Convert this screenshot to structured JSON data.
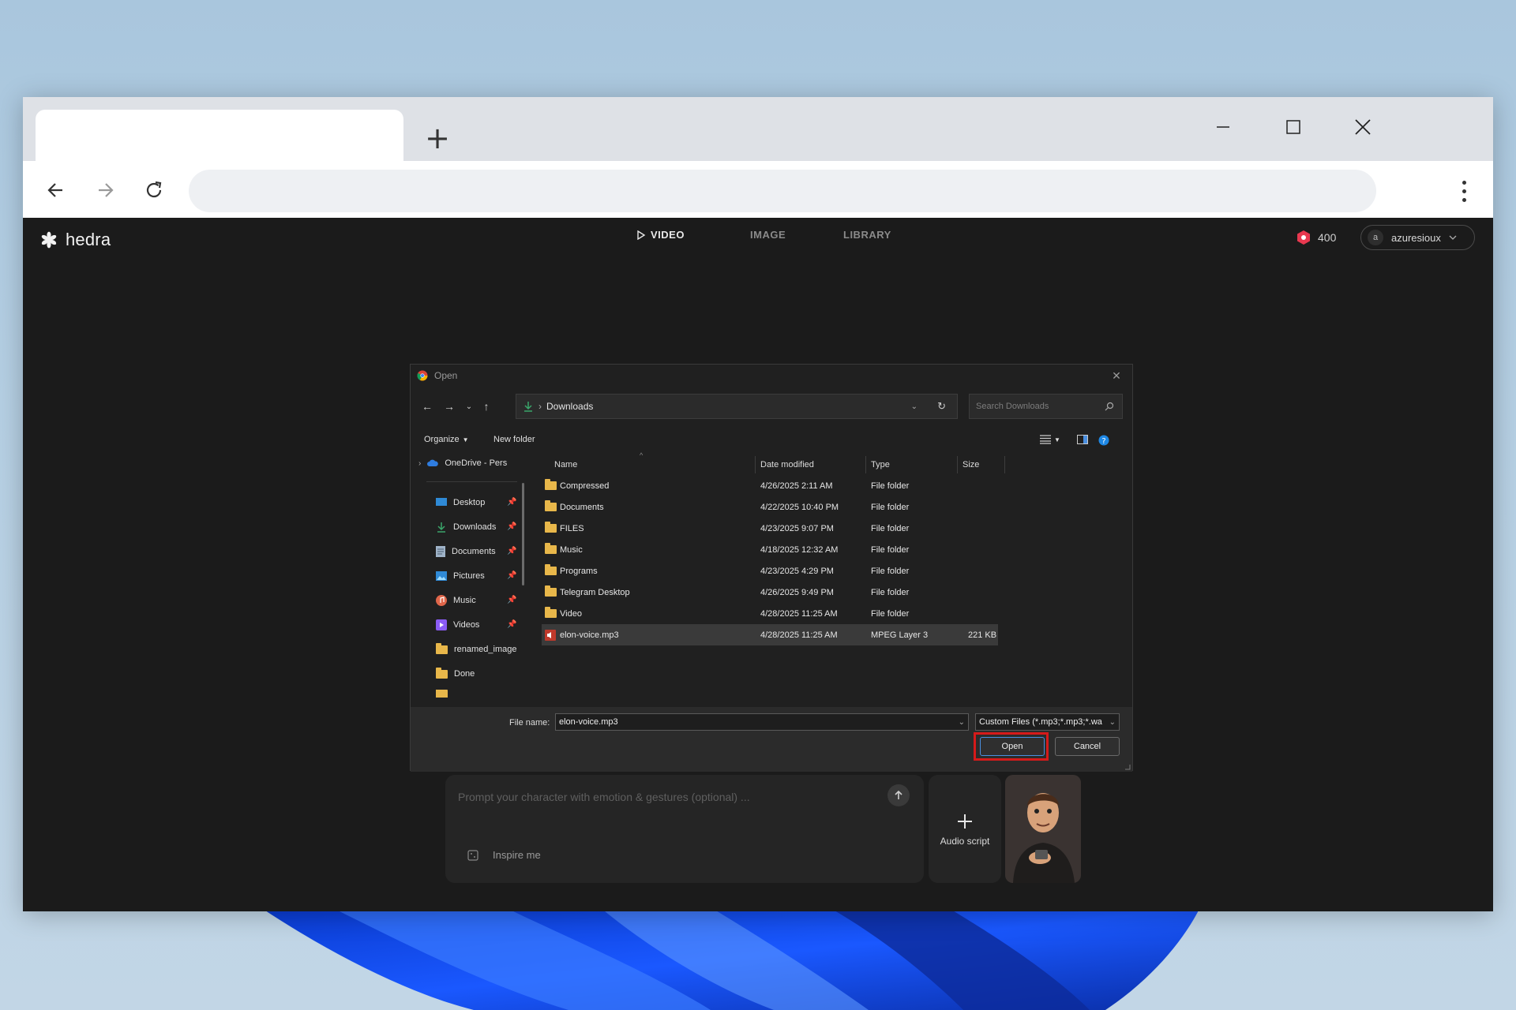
{
  "app": {
    "brand": "hedra",
    "nav": [
      {
        "label": "VIDEO",
        "active": true
      },
      {
        "label": "IMAGE",
        "active": false
      },
      {
        "label": "LIBRARY",
        "active": false
      }
    ],
    "credits": "400",
    "user": {
      "initial": "a",
      "name": "azuresioux"
    },
    "prompt_placeholder": "Prompt your character with emotion & gestures (optional) ...",
    "inspire_label": "Inspire me",
    "audio_script_label": "Audio script"
  },
  "dialog": {
    "title": "Open",
    "path": "Downloads",
    "search_placeholder": "Search Downloads",
    "organize_label": "Organize",
    "new_folder_label": "New folder",
    "nav_items": [
      {
        "label": "OneDrive - Pers",
        "icon": "cloud-icon"
      },
      {
        "label": "Desktop",
        "icon": "desktop-icon",
        "pinned": true
      },
      {
        "label": "Downloads",
        "icon": "download-icon",
        "pinned": true
      },
      {
        "label": "Documents",
        "icon": "document-icon",
        "pinned": true
      },
      {
        "label": "Pictures",
        "icon": "picture-icon",
        "pinned": true
      },
      {
        "label": "Music",
        "icon": "music-icon",
        "pinned": true
      },
      {
        "label": "Videos",
        "icon": "video-icon",
        "pinned": true
      },
      {
        "label": "renamed_image",
        "icon": "folder-icon"
      },
      {
        "label": "Done",
        "icon": "folder-icon"
      }
    ],
    "columns": {
      "name": "Name",
      "date": "Date modified",
      "type": "Type",
      "size": "Size"
    },
    "files": [
      {
        "name": "Compressed",
        "date": "4/26/2025 2:11 AM",
        "type": "File folder",
        "size": ""
      },
      {
        "name": "Documents",
        "date": "4/22/2025 10:40 PM",
        "type": "File folder",
        "size": ""
      },
      {
        "name": "FILES",
        "date": "4/23/2025 9:07 PM",
        "type": "File folder",
        "size": ""
      },
      {
        "name": "Music",
        "date": "4/18/2025 12:32 AM",
        "type": "File folder",
        "size": ""
      },
      {
        "name": "Programs",
        "date": "4/23/2025 4:29 PM",
        "type": "File folder",
        "size": ""
      },
      {
        "name": "Telegram Desktop",
        "date": "4/26/2025 9:49 PM",
        "type": "File folder",
        "size": ""
      },
      {
        "name": "Video",
        "date": "4/28/2025 11:25 AM",
        "type": "File folder",
        "size": ""
      },
      {
        "name": "elon-voice.mp3",
        "date": "4/28/2025 11:25 AM",
        "type": "MPEG Layer 3",
        "size": "221 KB"
      }
    ],
    "file_name_label": "File name:",
    "file_name_value": "elon-voice.mp3",
    "file_type_value": "Custom Files (*.mp3;*.mp3;*.wa",
    "open_label": "Open",
    "cancel_label": "Cancel",
    "highlight_color": "#d51a1a"
  }
}
